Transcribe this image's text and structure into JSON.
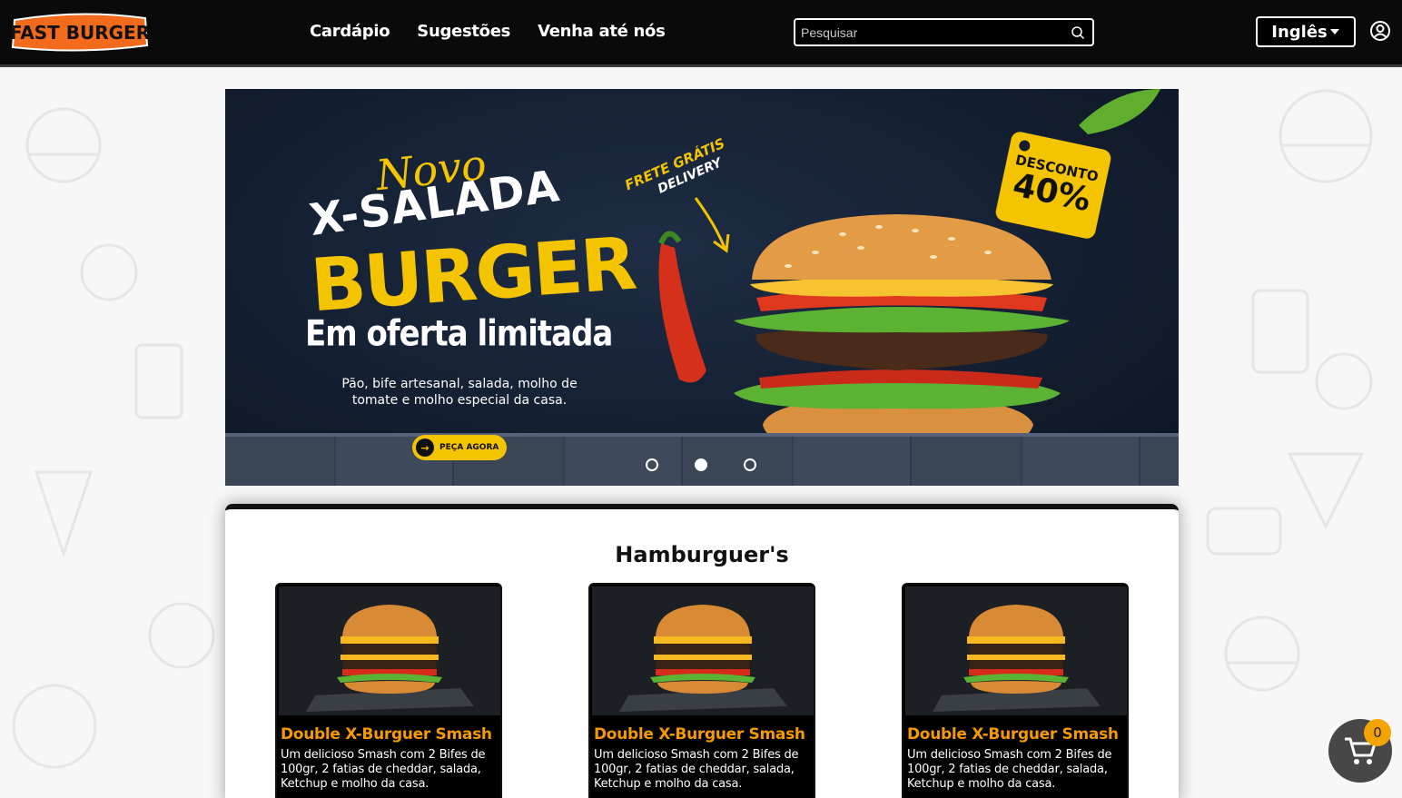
{
  "brand": {
    "logo_text": "FAST BURGER"
  },
  "nav": {
    "links": [
      "Cardápio",
      "Sugestões",
      "Venha até nós"
    ]
  },
  "search": {
    "placeholder": "Pesquisar"
  },
  "language": {
    "label": "Inglês"
  },
  "banner": {
    "novo": "Novo",
    "title_line1": "X-SALADA",
    "title_line2": "BURGER",
    "subtitle": "Em oferta limitada",
    "description": "Pão, bife artesanal, salada, molho de tomate e molho especial da casa.",
    "cta": "PEÇA AGORA",
    "frete": "FRETE GRÁTIS",
    "delivery": "DELIVERY",
    "discount_label": "DESCONTO",
    "discount_value": "40%",
    "slides": 3,
    "active_slide": 1
  },
  "menu": {
    "title": "Hamburguer's",
    "items": [
      {
        "name": "Double X-Burguer Smash",
        "description": "Um delicioso Smash com 2 Bifes de 100gr, 2 fatias de cheddar, salada, Ketchup e molho da casa."
      },
      {
        "name": "Double X-Burguer Smash",
        "description": "Um delicioso Smash com 2 Bifes de 100gr, 2 fatias de cheddar, salada, Ketchup e molho da casa."
      },
      {
        "name": "Double X-Burguer Smash",
        "description": "Um delicioso Smash com 2 Bifes de 100gr, 2 fatias de cheddar, salada, Ketchup e molho da casa."
      }
    ]
  },
  "cart": {
    "count": "0"
  },
  "colors": {
    "accent": "#f5c400",
    "orange": "#f59a00",
    "navbar": "#0a0a0a",
    "banner_bg": "#131e30"
  }
}
